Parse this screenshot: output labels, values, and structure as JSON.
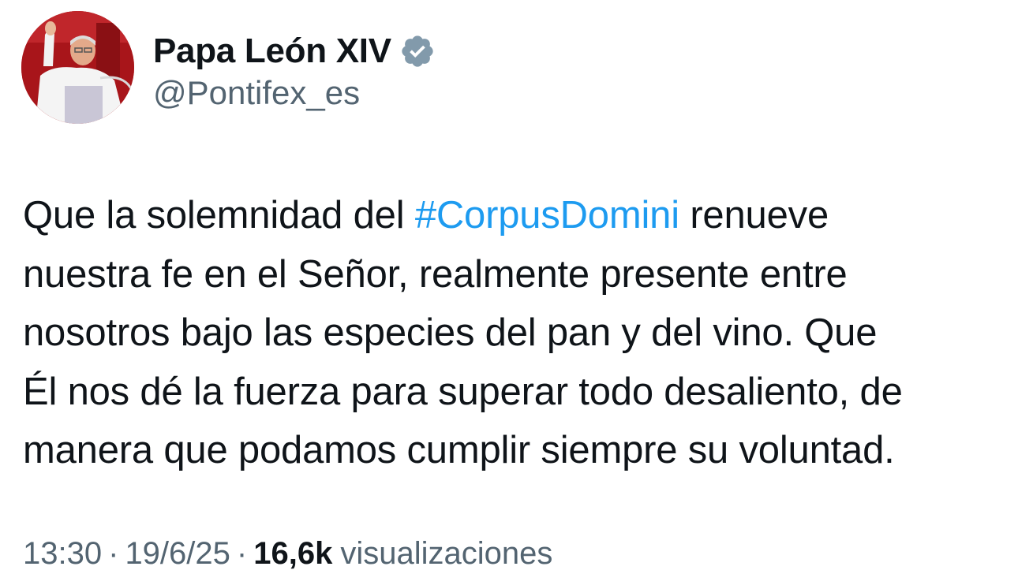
{
  "author": {
    "display_name": "Papa León XIV",
    "handle": "@Pontifex_es",
    "verified_badge_color": "#829aab"
  },
  "tweet": {
    "text_lines": [
      {
        "before": "Que la solemnidad del ",
        "hashtag": "#CorpusDomini",
        "after": " renueve"
      },
      {
        "text": "nuestra fe en el Señor, realmente presente entre"
      },
      {
        "text": "nosotros bajo las especies del pan y del vino. Que"
      },
      {
        "text": "Él nos dé la fuerza para superar todo desaliento, de"
      },
      {
        "text": "manera que podamos cumplir siempre su voluntad."
      }
    ],
    "hashtag_color": "#1d9bf0"
  },
  "meta": {
    "time": "13:30",
    "date": "19/6/25",
    "separator": "·",
    "views_count": "16,6k",
    "views_label": "visualizaciones"
  }
}
